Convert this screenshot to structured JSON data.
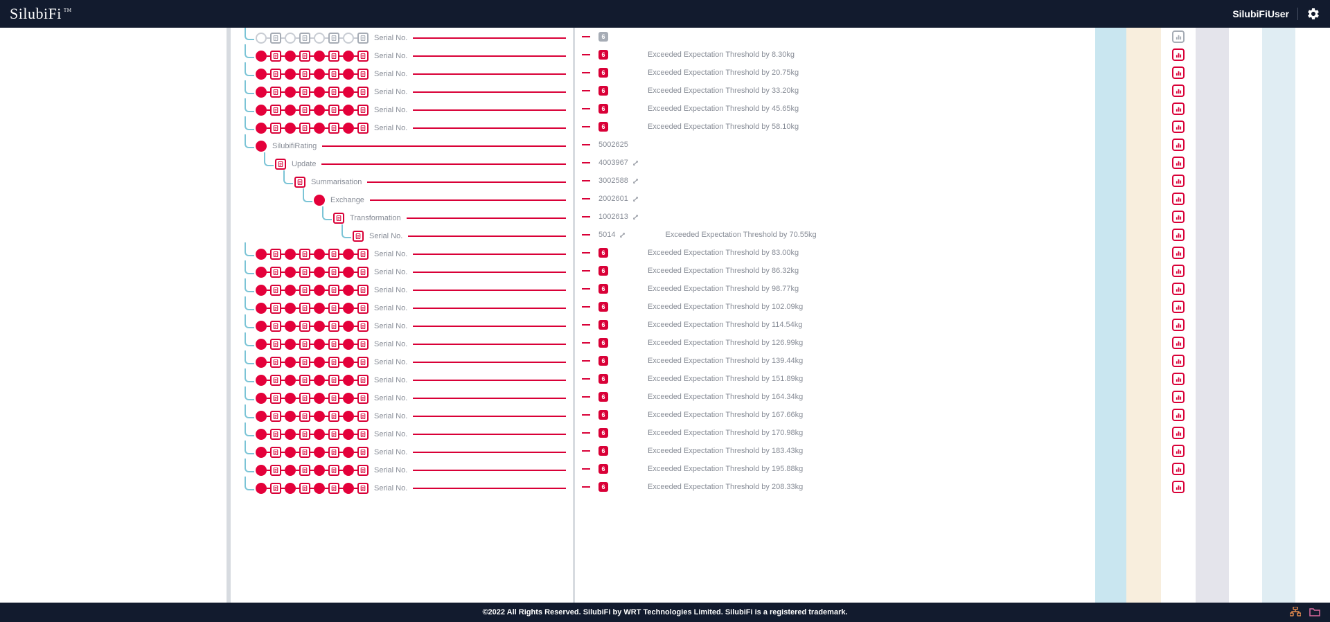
{
  "brand": "SilubiFi",
  "brandTm": "TM",
  "user": "SilubiFiUser",
  "footer": "©2022 All Rights Reserved. SilubiFi by WRT Technologies Limited. SilubiFi is a registered trademark.",
  "labels": {
    "serial": "Serial No.",
    "rating": "SilubifiRating",
    "update": "Update",
    "summarisation": "Summarisation",
    "exchange": "Exchange",
    "transformation": "Transformation"
  },
  "rows": [
    {
      "type": "prefix",
      "indent": 20,
      "chain": "empty",
      "label": "serial",
      "mid": {
        "kind": "badge",
        "badge": "6",
        "grey": true
      },
      "action": "grey"
    },
    {
      "type": "prefix",
      "indent": 20,
      "chain": "red",
      "label": "serial",
      "mid": {
        "kind": "badge",
        "badge": "6",
        "msg": "Exceeded Expectation Threshold by 8.30kg"
      }
    },
    {
      "type": "prefix",
      "indent": 20,
      "chain": "red",
      "label": "serial",
      "mid": {
        "kind": "badge",
        "badge": "6",
        "msg": "Exceeded Expectation Threshold by 20.75kg"
      }
    },
    {
      "type": "prefix",
      "indent": 20,
      "chain": "red",
      "label": "serial",
      "mid": {
        "kind": "badge",
        "badge": "6",
        "msg": "Exceeded Expectation Threshold by 33.20kg"
      }
    },
    {
      "type": "prefix",
      "indent": 20,
      "chain": "red",
      "label": "serial",
      "mid": {
        "kind": "badge",
        "badge": "6",
        "msg": "Exceeded Expectation Threshold by 45.65kg"
      }
    },
    {
      "type": "prefix",
      "indent": 20,
      "chain": "red",
      "label": "serial",
      "mid": {
        "kind": "badge",
        "badge": "6",
        "msg": "Exceeded Expectation Threshold by 58.10kg"
      }
    },
    {
      "type": "single",
      "indent": 20,
      "node": "full",
      "label": "rating",
      "mid": {
        "kind": "text",
        "val": "5002625"
      }
    },
    {
      "type": "single",
      "indent": 48,
      "node": "doc",
      "label": "update",
      "mid": {
        "kind": "textlink",
        "val": "4003967"
      }
    },
    {
      "type": "single",
      "indent": 76,
      "node": "doc",
      "label": "summarisation",
      "mid": {
        "kind": "textlink",
        "val": "3002588"
      }
    },
    {
      "type": "single",
      "indent": 104,
      "node": "full",
      "label": "exchange",
      "mid": {
        "kind": "textlink",
        "val": "2002601"
      }
    },
    {
      "type": "single",
      "indent": 132,
      "node": "doc",
      "label": "transformation",
      "mid": {
        "kind": "textlink",
        "val": "1002613"
      }
    },
    {
      "type": "single",
      "indent": 160,
      "node": "doc",
      "label": "serial",
      "mid": {
        "kind": "textlink",
        "val": "5014",
        "msg": "Exceeded Expectation Threshold by 70.55kg"
      }
    },
    {
      "type": "prefix",
      "indent": 20,
      "chain": "red",
      "label": "serial",
      "mid": {
        "kind": "badge",
        "badge": "6",
        "msg": "Exceeded Expectation Threshold by 83.00kg"
      }
    },
    {
      "type": "prefix",
      "indent": 20,
      "chain": "red",
      "label": "serial",
      "mid": {
        "kind": "badge",
        "badge": "6",
        "msg": "Exceeded Expectation Threshold by 86.32kg"
      }
    },
    {
      "type": "prefix",
      "indent": 20,
      "chain": "red",
      "label": "serial",
      "mid": {
        "kind": "badge",
        "badge": "6",
        "msg": "Exceeded Expectation Threshold by 98.77kg"
      }
    },
    {
      "type": "prefix",
      "indent": 20,
      "chain": "red",
      "label": "serial",
      "mid": {
        "kind": "badge",
        "badge": "6",
        "msg": "Exceeded Expectation Threshold by 102.09kg"
      }
    },
    {
      "type": "prefix",
      "indent": 20,
      "chain": "red",
      "label": "serial",
      "mid": {
        "kind": "badge",
        "badge": "6",
        "msg": "Exceeded Expectation Threshold by 114.54kg"
      }
    },
    {
      "type": "prefix",
      "indent": 20,
      "chain": "red",
      "label": "serial",
      "mid": {
        "kind": "badge",
        "badge": "6",
        "msg": "Exceeded Expectation Threshold by 126.99kg"
      }
    },
    {
      "type": "prefix",
      "indent": 20,
      "chain": "red",
      "label": "serial",
      "mid": {
        "kind": "badge",
        "badge": "6",
        "msg": "Exceeded Expectation Threshold by 139.44kg"
      }
    },
    {
      "type": "prefix",
      "indent": 20,
      "chain": "red",
      "label": "serial",
      "mid": {
        "kind": "badge",
        "badge": "6",
        "msg": "Exceeded Expectation Threshold by 151.89kg"
      }
    },
    {
      "type": "prefix",
      "indent": 20,
      "chain": "red",
      "label": "serial",
      "mid": {
        "kind": "badge",
        "badge": "6",
        "msg": "Exceeded Expectation Threshold by 164.34kg"
      }
    },
    {
      "type": "prefix",
      "indent": 20,
      "chain": "red",
      "label": "serial",
      "mid": {
        "kind": "badge",
        "badge": "6",
        "msg": "Exceeded Expectation Threshold by 167.66kg"
      }
    },
    {
      "type": "prefix",
      "indent": 20,
      "chain": "red",
      "label": "serial",
      "mid": {
        "kind": "badge",
        "badge": "6",
        "msg": "Exceeded Expectation Threshold by 170.98kg"
      }
    },
    {
      "type": "prefix",
      "indent": 20,
      "chain": "red",
      "label": "serial",
      "mid": {
        "kind": "badge",
        "badge": "6",
        "msg": "Exceeded Expectation Threshold by 183.43kg"
      }
    },
    {
      "type": "prefix",
      "indent": 20,
      "chain": "red",
      "label": "serial",
      "mid": {
        "kind": "badge",
        "badge": "6",
        "msg": "Exceeded Expectation Threshold by 195.88kg"
      }
    },
    {
      "type": "prefix",
      "indent": 20,
      "chain": "red",
      "label": "serial",
      "mid": {
        "kind": "badge",
        "badge": "6",
        "msg": "Exceeded Expectation Threshold by 208.33kg"
      }
    }
  ]
}
